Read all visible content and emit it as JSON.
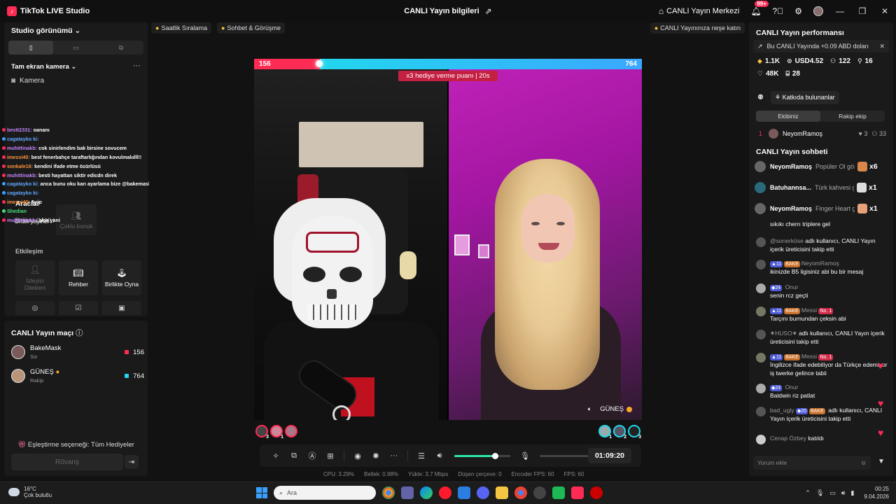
{
  "titlebar": {
    "app_name": "TikTok LIVE Studio",
    "center_title": "CANLI Yayın bilgileri",
    "live_center": "CANLI Yayın Merkezi",
    "notif_badge": "99+"
  },
  "left": {
    "studio_view": "Studio görünümü",
    "fullscreen_camera": "Tam ekran kamera",
    "camera": "Kamera",
    "tools": "Araclar",
    "go_live_together": "Birlikte CANLI Yayın yapın",
    "tool_cards": [
      "Ortak yayinci",
      "Çoklu konuk"
    ],
    "interaction": "Etkileşim",
    "interaction_cards": [
      "İzleyici Dilekleri",
      "Rehber",
      "Birlikte Oyna"
    ],
    "overlay_chat": [
      {
        "name": "bestt2331:",
        "text": "oananı"
      },
      {
        "name": "cagatayko ki:",
        "text": ""
      },
      {
        "name": "muhittinakb:",
        "text": "cok sinirlendim bak birsine sovucem"
      },
      {
        "name": "imessi40:",
        "text": "best fenerbahçe taraftarlığından kovulmalıılll!!"
      },
      {
        "name": "sonkale16:",
        "text": "kendini ifade etme özürlüsü"
      },
      {
        "name": "muhittinakb:",
        "text": "besti hayattan siktir edicdn direk"
      },
      {
        "name": "cagatayko ki:",
        "text": "anca bunu oku karı ayarlama bize @bakemask"
      },
      {
        "name": "cagatayko ki:",
        "text": ""
      },
      {
        "name": "imessi40:",
        "text": "Ayip"
      },
      {
        "name": "Shedian",
        "text": ""
      },
      {
        "name": "muhittinakb:",
        "text": "olsa yani"
      }
    ]
  },
  "match": {
    "title": "CANLI Yayın maçı",
    "players": [
      {
        "name": "BakeMask",
        "role": "Siz",
        "score": "156",
        "color": "#fe2c55"
      },
      {
        "name": "GÜNEŞ",
        "role": "Rakip",
        "score": "764",
        "color": "#23d6ee"
      }
    ],
    "option": "Eşleştirme seçeneği: Tüm Hediyeler",
    "rematch": "Rövanş"
  },
  "chips": {
    "hourly": "Saatlik Sıralama",
    "chat_meet": "Sohbet & Görüşme",
    "happy": "CANLI Yayınınıza neşe katın"
  },
  "battle": {
    "left_score": "156",
    "right_score": "764",
    "left_share": 0.17,
    "multiplier": "x3 hediye verme puanı",
    "mult_time": "20s",
    "right_name": "GÜNEŞ",
    "left_gifters": [
      "3",
      "1",
      ""
    ],
    "right_gifters": [
      "1",
      "2",
      "3"
    ]
  },
  "controls": {
    "timer": "01:09:20",
    "volume_level": 0.72
  },
  "stats": [
    "CPU: 3.29%",
    "Bellek: 0.98%",
    "Yükle: 3.7 Mbps",
    "Düşen çerçeve: 0",
    "Encoder FPS: 60",
    "FPS: 60"
  ],
  "right": {
    "performance": "CANLI Yayın performansı",
    "notice": "Bu CANLI Yayında +0.09 ABD doları",
    "metrics": {
      "diamonds": "1.1K",
      "usd": "USD4.52",
      "viewers": "122",
      "new_followers": "16",
      "likes": "48K",
      "gifters": "28"
    },
    "contributors": "Katkıda bulunanlar",
    "team_tabs": [
      "Ekibiniz",
      "Rakip ekip"
    ],
    "rank": {
      "pos": "1",
      "name": "NeyomRamoş",
      "hearts": "3",
      "extra": "33"
    },
    "chat_title": "CANLI Yayın sohbeti",
    "gifts": [
      {
        "name": "NeyomRamoş",
        "msg": "Popüler Ol gönd",
        "count": "x6"
      },
      {
        "name": "Batuhannsa...",
        "msg": "Türk kahvesi gö",
        "count": "x1"
      },
      {
        "name": "NeyomRamoş",
        "msg": "Finger Heart gö",
        "count": "x1"
      }
    ],
    "chat": [
      {
        "user": "",
        "text": "sıkıkı cherrı triplere gel"
      },
      {
        "user": "@sonerköse",
        "text": "adlı kullanıcı, CANLI Yayın içerik üreticisini takip etti"
      },
      {
        "user": "NeyomRamoş",
        "lvl": "11",
        "fan": "BAKE",
        "text": "ikinizde B5 ligisiniz abi bu bir mesaj"
      },
      {
        "user": "Onur",
        "lvl": "24",
        "text": "senin rcz geçti"
      },
      {
        "user": "Messi",
        "lvl": "11",
        "fan": "BAKE",
        "top": "No. 1",
        "text": "Tarçını burnundan çeksin abi"
      },
      {
        "user": "✷HUSO✷",
        "text": "adlı kullanıcı, CANLI Yayın içerik üreticisini takip etti"
      },
      {
        "user": "Messi",
        "lvl": "11",
        "fan": "BAKE",
        "top": "No. 1",
        "text": "İngilizce ifade edebiliyor da Türkçe edemiyor iş twerke gelince tabii"
      },
      {
        "user": "Onur",
        "lvl": "24",
        "text": "Baldwin riz patlat"
      },
      {
        "user": "bad_ugly",
        "lvl": "20",
        "fan": "BAKE",
        "text": "adlı kullanıcı, CANLI Yayın içerik üreticisini takip etti"
      },
      {
        "user": "Cenap Özbey",
        "text": "katıldı"
      }
    ],
    "comment_placeholder": "Yorum ekle"
  },
  "taskbar": {
    "temp": "16°C",
    "weather": "Çok bulutlu",
    "search": "Ara",
    "time": "00:25",
    "date": "9.04.2026"
  }
}
